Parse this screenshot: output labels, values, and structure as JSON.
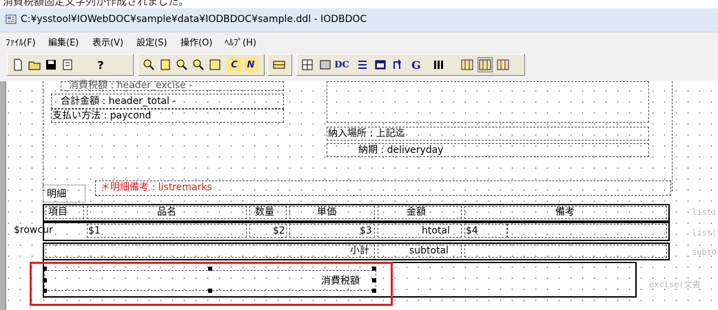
{
  "window": {
    "caption_cropped": "消費税額固定文字列が作成されました。",
    "title": "C:¥ysstool¥IOWebDOC¥sample¥data¥IODBDOC¥sample.ddl - IODBDOC"
  },
  "menu": [
    {
      "label": "ﾌｧｲﾙ(F)"
    },
    {
      "label": "編集(E)"
    },
    {
      "label": "表示(V)"
    },
    {
      "label": "設定(S)"
    },
    {
      "label": "操作(O)"
    },
    {
      "label": "ﾍﾙﾌﾟ(H)"
    }
  ],
  "toolbar": {
    "buttons": [
      "new-file-icon",
      "open-folder-icon",
      "save-icon",
      "document-icon",
      "help-icon",
      "zoom-in-icon",
      "page-icon",
      "zoom-out-icon",
      "zoom-fit-icon",
      "grid-icon",
      "italic-c-icon",
      "bold-n-icon",
      "box-icon",
      "table-icon",
      "frame-icon",
      "dc-icon",
      "align-icon",
      "window-icon",
      "flow-icon",
      "g-icon",
      "bars-icon",
      "layout1-icon",
      "layout2-icon",
      "layout3-icon"
    ],
    "labels": {
      "c": "C",
      "n": "N",
      "dc": "DC",
      "g": "G"
    }
  },
  "canvas": {
    "fields": {
      "excise_header": "消費税額 : header_excise -",
      "total_header": "合計金額 : header_total -",
      "paycond": "支払い方法 : paycond",
      "delivery_place": "納入場所 : 上記迄",
      "delivery_day": "納期 : deliveryday",
      "section_label": "明細",
      "listremarks": "＊明細備考 : listremarks"
    },
    "table": {
      "headers": [
        "項目",
        "品名",
        "数量",
        "単価",
        "金額",
        "備考"
      ],
      "row_label": "$rowcur",
      "row_values": [
        "$1",
        "$2",
        "$3",
        "htotal",
        "$4"
      ],
      "subtotal_label": "小計",
      "subtotal_value": "subtotal",
      "excise_label": "消費税額"
    },
    "right_notes": [
      "listi",
      "list(ﾌ",
      "subtot",
      "excise(文書"
    ]
  },
  "colors": {
    "highlight_box": "#e02020",
    "remarks_text": "#e02020"
  }
}
